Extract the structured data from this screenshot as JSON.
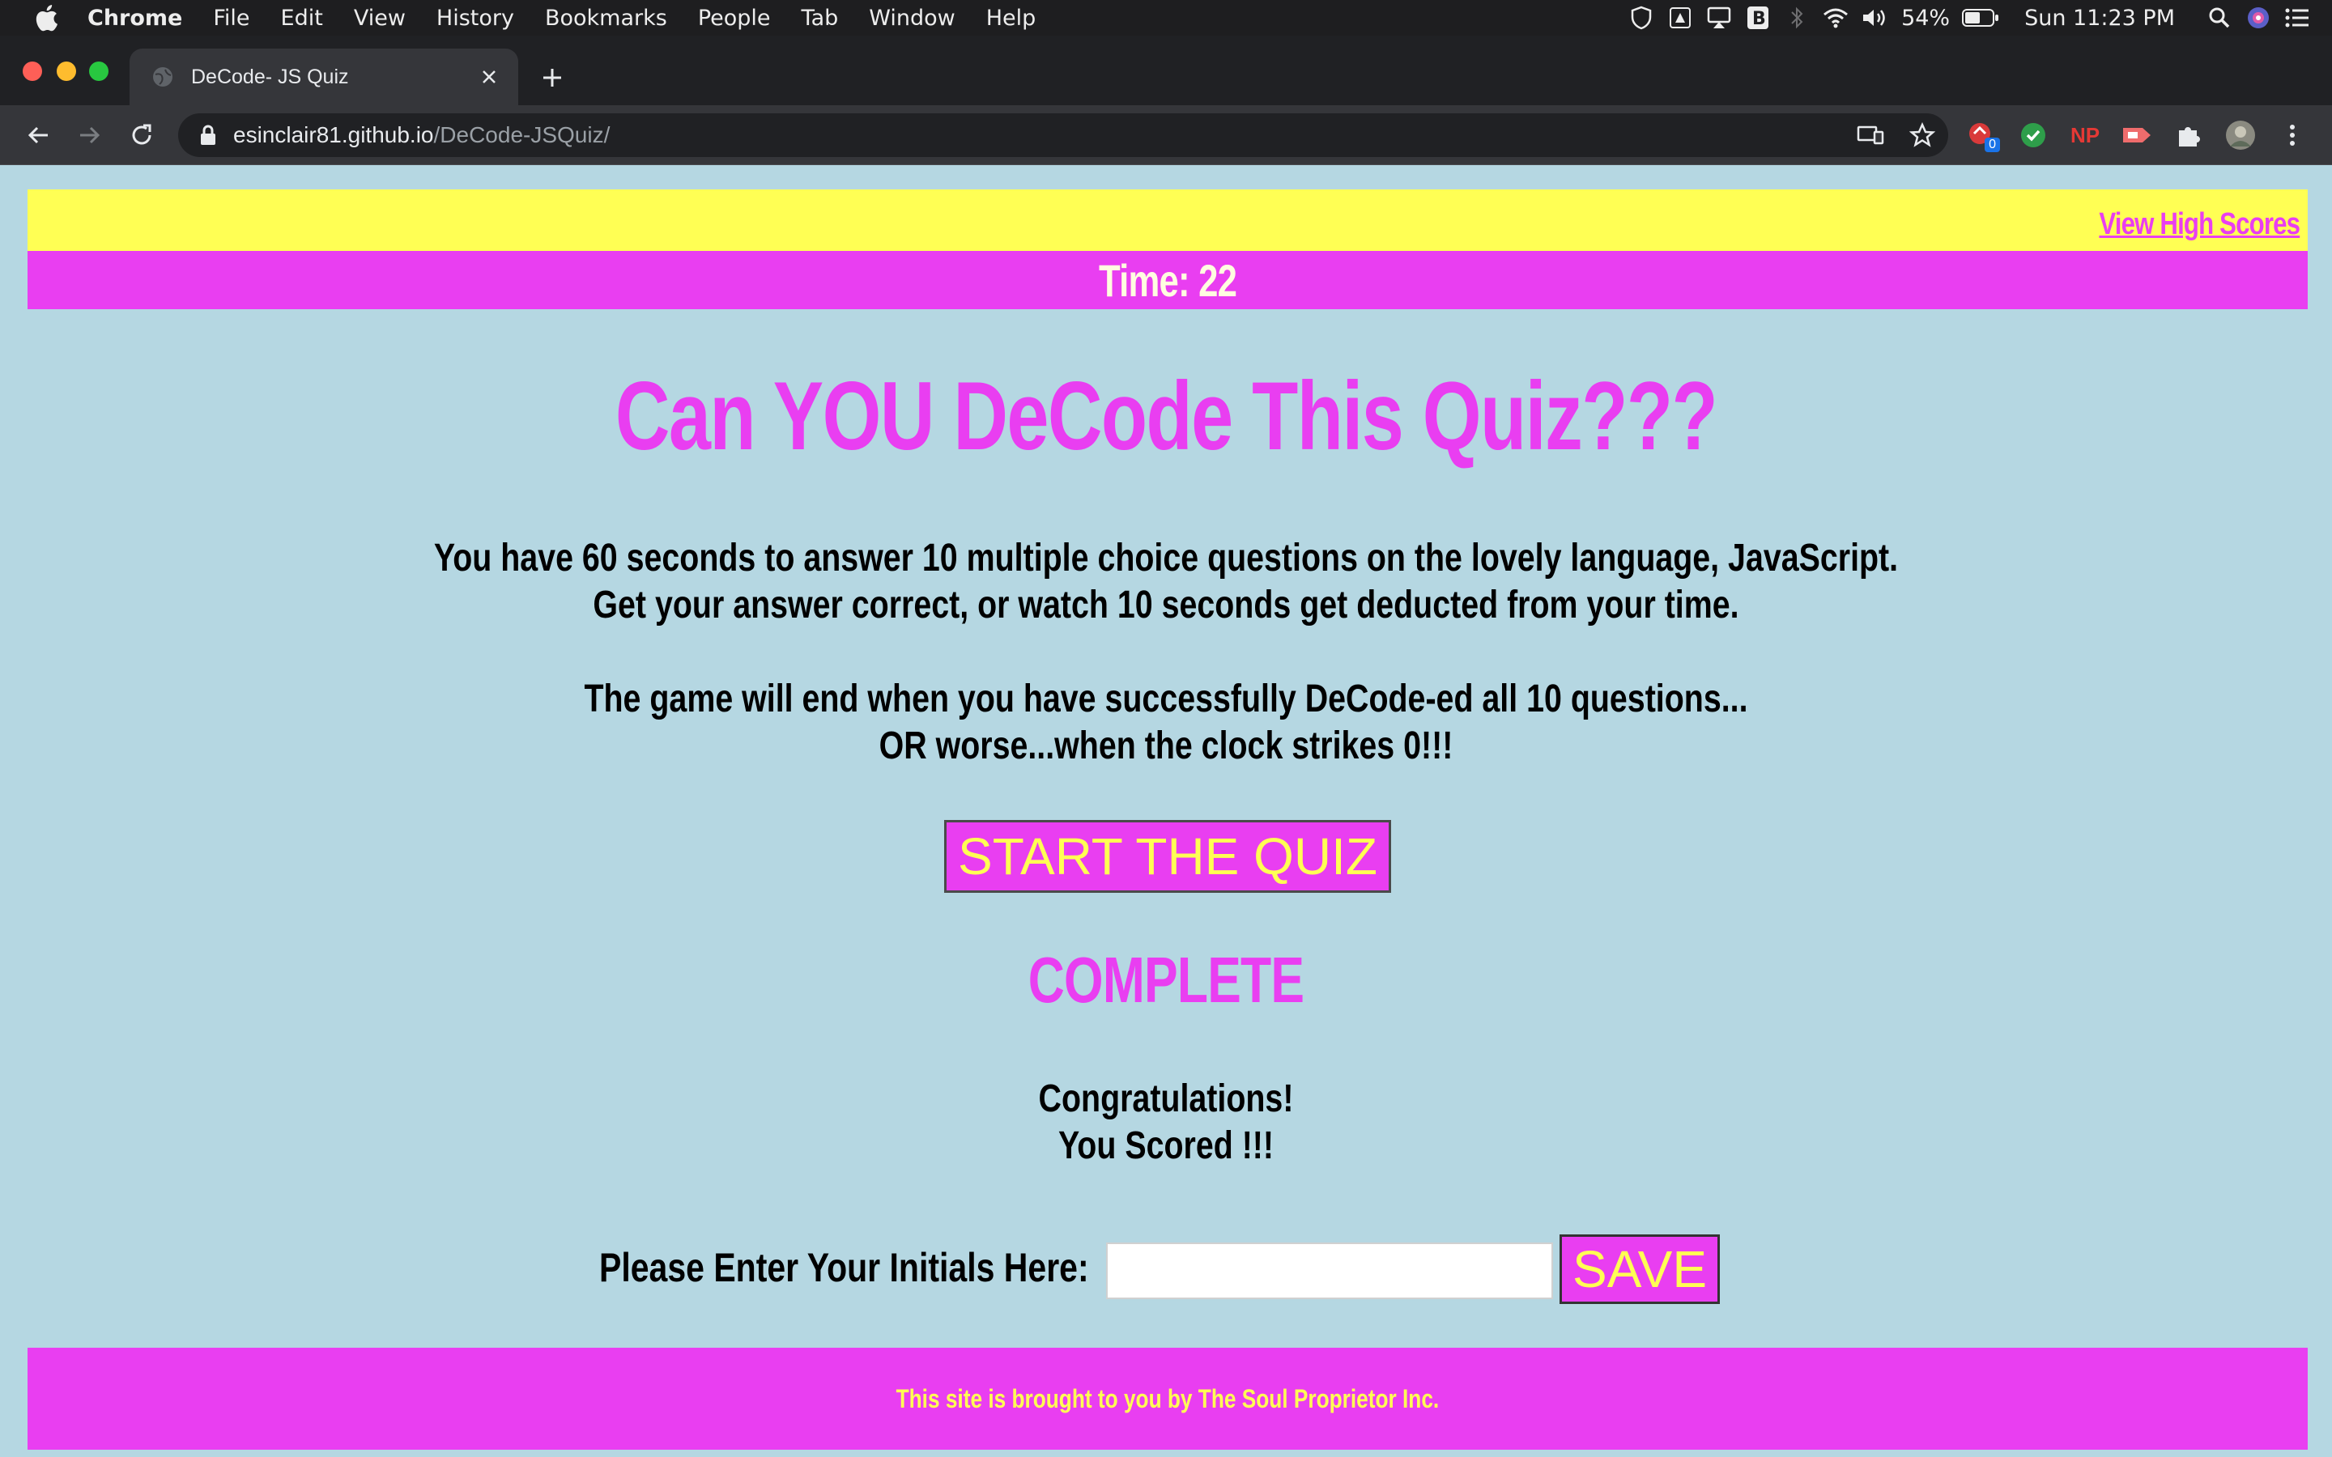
{
  "menubar": {
    "app_name": "Chrome",
    "items": [
      "File",
      "Edit",
      "View",
      "History",
      "Bookmarks",
      "People",
      "Tab",
      "Window",
      "Help"
    ],
    "battery": "54%",
    "clock": "Sun 11:23 PM"
  },
  "browser": {
    "tab_title": "DeCode- JS Quiz",
    "url_host": "esinclair81.github.io",
    "url_path": "/DeCode-JSQuiz/",
    "extension_badge": "0",
    "extension_np_label": "NP"
  },
  "quiz": {
    "high_scores_link": "View High Scores",
    "timer": "Time: 22",
    "title": "Can YOU DeCode This Quiz???",
    "intro_line1": "You have 60 seconds to answer 10 multiple choice questions on the lovely language, JavaScript.",
    "intro_line2": "Get your answer correct, or watch 10 seconds get deducted from your time.",
    "intro_line3": "The game will end when you have successfully DeCode-ed all 10 questions...",
    "intro_line4": "OR worse...when the clock strikes 0!!!",
    "start_button": "START THE QUIZ",
    "complete_heading": "COMPLETE",
    "congrats_line1": "Congratulations!",
    "congrats_line2": "You Scored !!!",
    "initials_label": "Please Enter Your Initials Here:",
    "initials_value": "",
    "save_button": "SAVE",
    "footer": "This site is brought to you by The Soul Proprietor Inc."
  },
  "colors": {
    "page_bg": "#b5d7e2",
    "yellow": "#ffff54",
    "magenta": "#e93ef1"
  }
}
